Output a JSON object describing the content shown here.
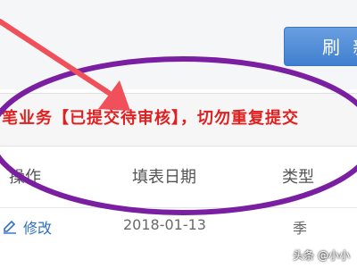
{
  "toolbar": {
    "refresh_label": "刷 新"
  },
  "notice": {
    "text": "笔业务【已提交待审核】，切勿重复提交"
  },
  "table": {
    "headers": [
      "操作",
      "填表日期",
      "类型"
    ],
    "rows": [
      {
        "action": "修改",
        "date": "2018-01-13",
        "type": "季"
      }
    ]
  },
  "watermark": {
    "text": "头条 @小小"
  },
  "colors": {
    "notice_text": "#e02020",
    "button_bg": "#4a86d6",
    "link": "#2f6fc8",
    "annotation_arrow": "#f0505a",
    "annotation_ellipse": "#7a1fa2"
  },
  "icons": {
    "edit": "pencil-icon"
  }
}
